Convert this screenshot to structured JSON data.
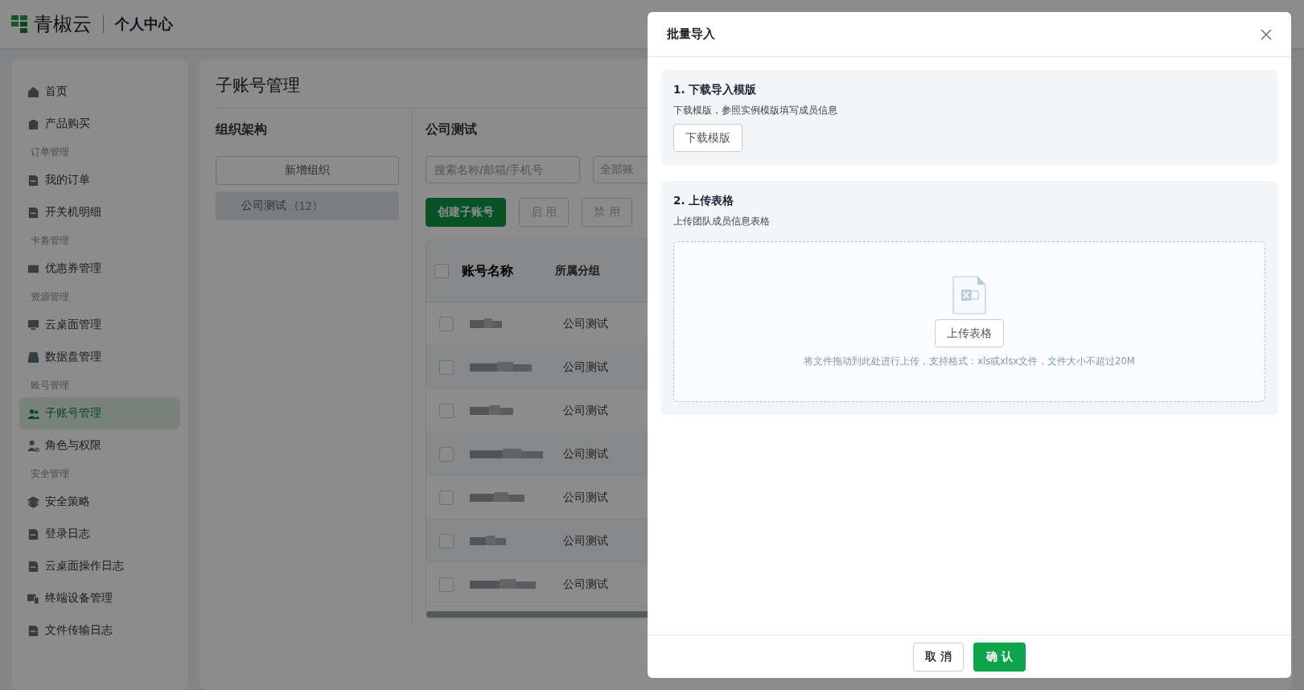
{
  "header": {
    "brand": "青椒云",
    "section": "个人中心"
  },
  "sidebar": {
    "items": [
      {
        "kind": "item",
        "label": "首页",
        "selected": false
      },
      {
        "kind": "item",
        "label": "产品购买",
        "selected": false
      },
      {
        "kind": "section",
        "label": "订单管理"
      },
      {
        "kind": "item",
        "label": "我的订单",
        "selected": false
      },
      {
        "kind": "item",
        "label": "开关机明细",
        "selected": false
      },
      {
        "kind": "section",
        "label": "卡劵管理"
      },
      {
        "kind": "item",
        "label": "优惠券管理",
        "selected": false
      },
      {
        "kind": "section",
        "label": "资源管理"
      },
      {
        "kind": "item",
        "label": "云桌面管理",
        "selected": false
      },
      {
        "kind": "item",
        "label": "数据盘管理",
        "selected": false
      },
      {
        "kind": "section",
        "label": "账号管理"
      },
      {
        "kind": "item",
        "label": "子账号管理",
        "selected": true
      },
      {
        "kind": "item",
        "label": "角色与权限",
        "selected": false
      },
      {
        "kind": "section",
        "label": "安全管理"
      },
      {
        "kind": "item",
        "label": "安全策略",
        "selected": false
      },
      {
        "kind": "item",
        "label": "登录日志",
        "selected": false
      },
      {
        "kind": "item",
        "label": "云桌面操作日志",
        "selected": false
      },
      {
        "kind": "item",
        "label": "终端设备管理",
        "selected": false
      },
      {
        "kind": "item",
        "label": "文件传输日志",
        "selected": false
      }
    ]
  },
  "page": {
    "title": "子账号管理",
    "org": {
      "title": "组织架构",
      "add_button": "新增组织",
      "groups": [
        {
          "name": "公司测试",
          "count": "(12)",
          "selected": true
        }
      ]
    },
    "group_title": "公司测试",
    "search": {
      "placeholder": "搜索名称/邮箱/手机号"
    },
    "filter": {
      "value": "全部账"
    },
    "buttons": [
      {
        "label": "创建子账号",
        "kind": "primary"
      },
      {
        "label": "启 用",
        "kind": "default"
      },
      {
        "label": "禁 用",
        "kind": "default"
      }
    ],
    "table": {
      "select_all": false,
      "columns": [
        "账号名称",
        "所属分组"
      ],
      "rows": [
        {
          "checked": false,
          "group": "公司测试"
        },
        {
          "checked": false,
          "group": "公司测试"
        },
        {
          "checked": false,
          "group": "公司测试"
        },
        {
          "checked": false,
          "group": "公司测试"
        },
        {
          "checked": false,
          "group": "公司测试"
        },
        {
          "checked": false,
          "group": "公司测试"
        },
        {
          "checked": false,
          "group": "公司测试"
        }
      ]
    }
  },
  "modal": {
    "title": "批量导入",
    "step1": {
      "title": "1. 下载导入模版",
      "description": "下载模版，参照实例模版填写成员信息",
      "button": "下载模版"
    },
    "step2": {
      "title": "2. 上传表格",
      "description": "上传团队成员信息表格",
      "button": "上传表格",
      "hint": "将文件拖动到此处进行上传，支持格式：xls或xlsx文件，文件大小不超过20M"
    },
    "cancel": "取 消",
    "confirm": "确 认"
  }
}
